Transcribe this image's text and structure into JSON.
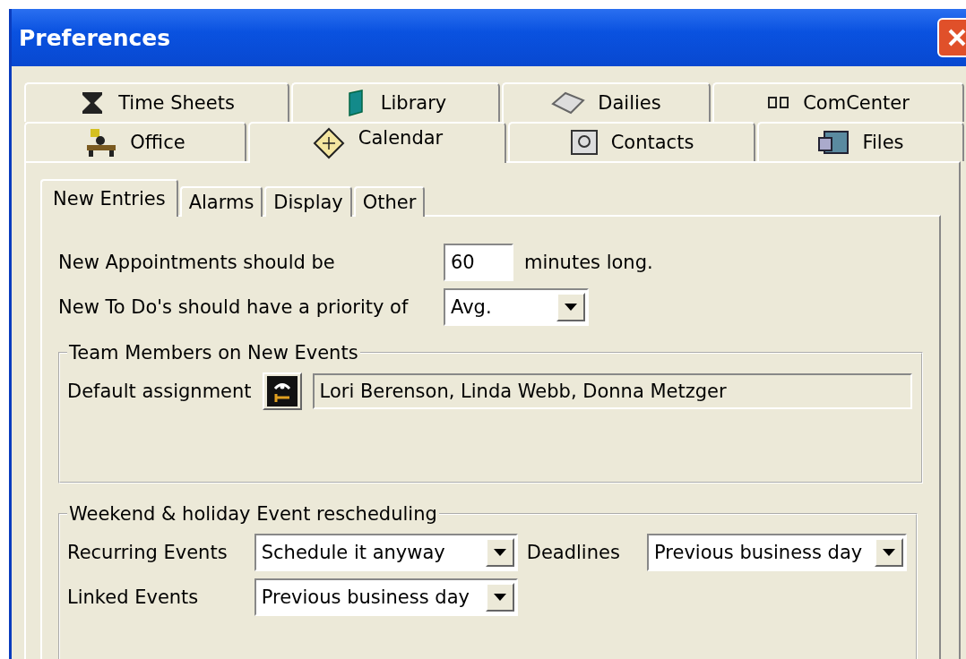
{
  "window": {
    "title": "Preferences"
  },
  "tab_rows": [
    {
      "tabs": [
        {
          "label": "Time Sheets",
          "selected": false
        },
        {
          "label": "Library",
          "selected": false
        },
        {
          "label": "Dailies",
          "selected": false
        },
        {
          "label": "ComCenter",
          "selected": false
        }
      ]
    },
    {
      "tabs": [
        {
          "label": "Office",
          "selected": false
        },
        {
          "label": "Calendar",
          "selected": true
        },
        {
          "label": "Contacts",
          "selected": false
        },
        {
          "label": "Files",
          "selected": false
        }
      ]
    }
  ],
  "sub_tabs": [
    {
      "label": "New Entries",
      "selected": true
    },
    {
      "label": "Alarms",
      "selected": false
    },
    {
      "label": "Display",
      "selected": false
    },
    {
      "label": "Other",
      "selected": false
    }
  ],
  "appointment_length": {
    "label": "New Appointments should be",
    "value": "60",
    "suffix": "minutes long."
  },
  "todo_priority": {
    "label": "New To Do's should have a priority of",
    "value": "Avg."
  },
  "team_members": {
    "title": "Team Members on New Events",
    "label": "Default assignment",
    "value": "Lori Berenson, Linda Webb, Donna Metzger"
  },
  "rescheduling": {
    "title": "Weekend & holiday Event rescheduling",
    "recurring": {
      "label": "Recurring Events",
      "value": "Schedule it anyway"
    },
    "deadlines": {
      "label": "Deadlines",
      "value": "Previous business day"
    },
    "linked": {
      "label": "Linked Events",
      "value": "Previous business day"
    }
  }
}
